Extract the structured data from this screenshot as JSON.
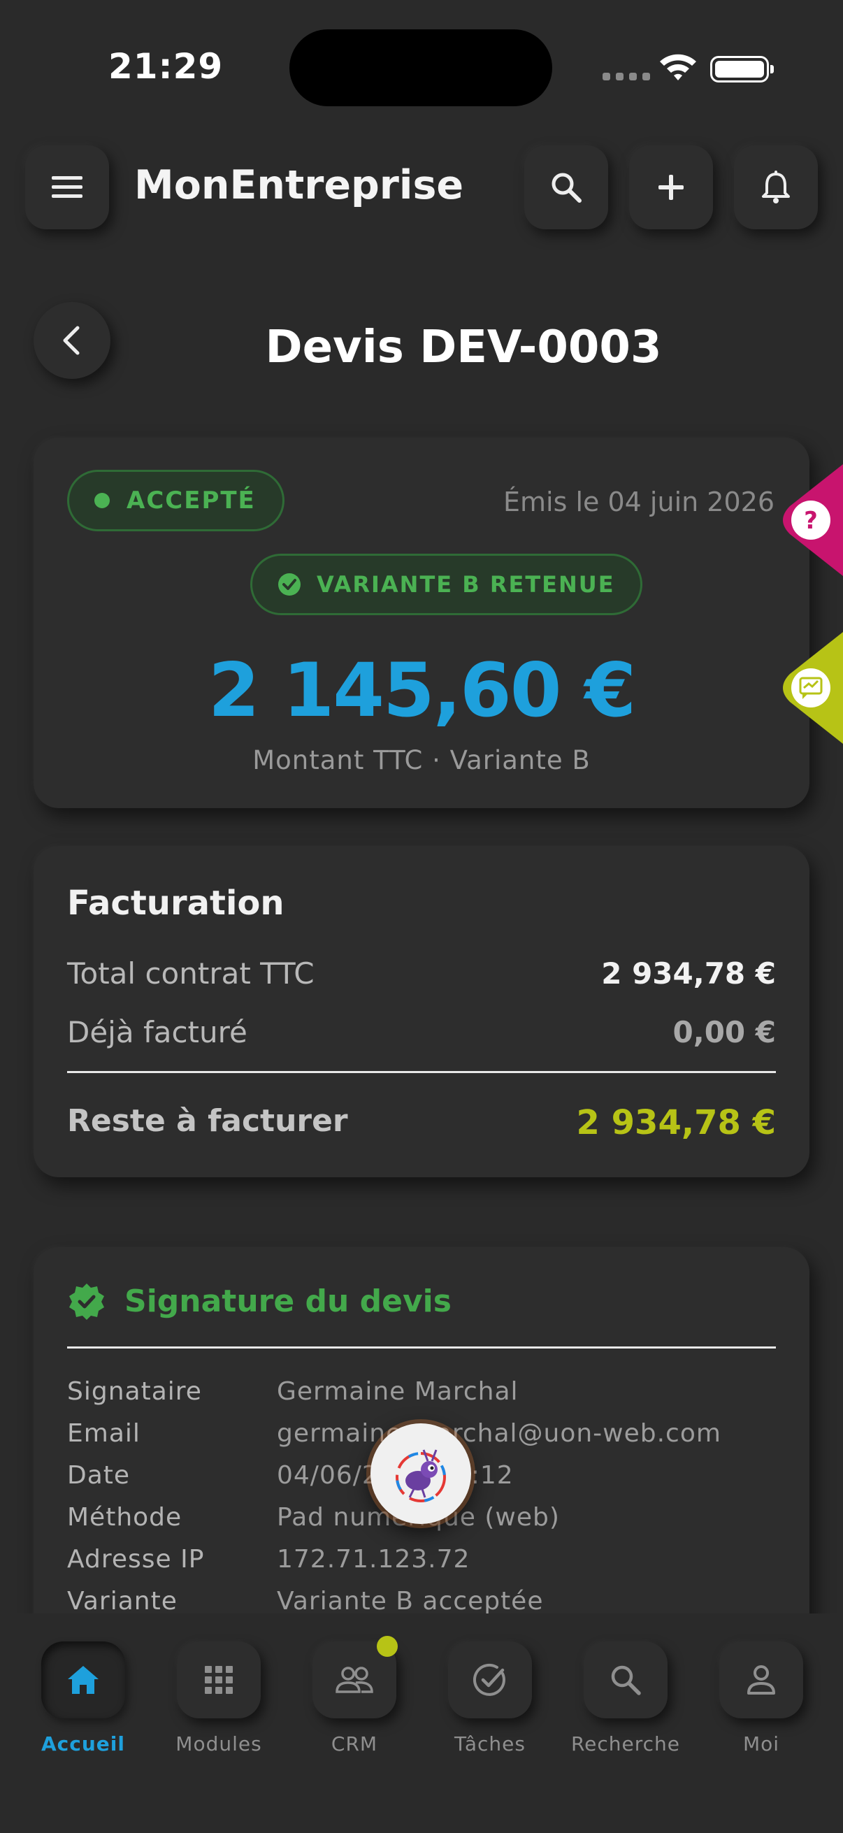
{
  "status_bar": {
    "time": "21:29"
  },
  "app_bar": {
    "title": "MonEntreprise"
  },
  "page": {
    "title": "Devis DEV-0003"
  },
  "summary": {
    "status_label": "ACCEPTÉ",
    "issued": "Émis le 04 juin 2026",
    "variant_badge": "VARIANTE B RETENUE",
    "amount": "2 145,60 €",
    "amount_caption": "Montant TTC · Variante B"
  },
  "billing": {
    "title": "Facturation",
    "rows": [
      {
        "label": "Total contrat TTC",
        "value": "2 934,78 €"
      },
      {
        "label": "Déjà facturé",
        "value": "0,00 €"
      }
    ],
    "remaining_label": "Reste à facturer",
    "remaining_value": "2 934,78 €"
  },
  "signature": {
    "title": "Signature du devis",
    "rows": [
      {
        "key": "Signataire",
        "value": "Germaine Marchal"
      },
      {
        "key": "Email",
        "value": "germaine.marchal@uon-web.com"
      },
      {
        "key": "Date",
        "value": "04/06/2026 12:12"
      },
      {
        "key": "Méthode",
        "value": "Pad numérique (web)"
      },
      {
        "key": "Adresse IP",
        "value": "172.71.123.72"
      },
      {
        "key": "Variante",
        "value": "Variante B acceptée"
      }
    ]
  },
  "bottom_nav": [
    {
      "label": "Accueil",
      "icon": "home-icon",
      "active": true
    },
    {
      "label": "Modules",
      "icon": "grid-icon"
    },
    {
      "label": "CRM",
      "icon": "people-icon",
      "badge": true
    },
    {
      "label": "Tâches",
      "icon": "check-circle-icon"
    },
    {
      "label": "Recherche",
      "icon": "search-icon"
    },
    {
      "label": "Moi",
      "icon": "person-icon"
    }
  ],
  "colors": {
    "accent_blue": "#1ea0dc",
    "success_green": "#4bb253",
    "lime": "#b7c316",
    "help_magenta": "#c8146e"
  }
}
